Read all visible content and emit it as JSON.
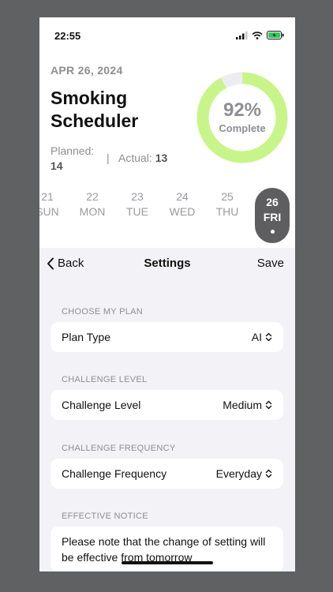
{
  "status_bar": {
    "time": "22:55"
  },
  "header": {
    "date": "APR 26, 2024",
    "title": "Smoking Scheduler",
    "planned_label": "Planned:",
    "planned_value": "14",
    "actual_label": "Actual:",
    "actual_value": "13",
    "separator": "|"
  },
  "progress": {
    "percent_text": "92%",
    "label": "Complete",
    "fraction": 0.92,
    "ring_color": "#c8f58a",
    "track_color": "#ececf2"
  },
  "days": [
    {
      "num": "21",
      "name": "SUN",
      "selected": false
    },
    {
      "num": "22",
      "name": "MON",
      "selected": false
    },
    {
      "num": "23",
      "name": "TUE",
      "selected": false
    },
    {
      "num": "24",
      "name": "WED",
      "selected": false
    },
    {
      "num": "25",
      "name": "THU",
      "selected": false
    },
    {
      "num": "26",
      "name": "FRI",
      "selected": true
    }
  ],
  "nav": {
    "back_label": "Back",
    "title": "Settings",
    "save_label": "Save"
  },
  "sections": {
    "plan": {
      "header": "CHOOSE MY PLAN",
      "label": "Plan Type",
      "value": "AI"
    },
    "level": {
      "header": "CHALLENGE LEVEL",
      "label": "Challenge Level",
      "value": "Medium"
    },
    "frequency": {
      "header": "CHALLENGE FREQUENCY",
      "label": "Challenge Frequency",
      "value": "Everyday"
    },
    "notice": {
      "header": "EFFECTIVE NOTICE",
      "text": "Please note that the change of setting will be effective from tomorrow"
    }
  },
  "icons": [
    "signal-icon",
    "wifi-icon",
    "battery-icon",
    "chevron-left-icon",
    "chevron-updown-icon"
  ]
}
